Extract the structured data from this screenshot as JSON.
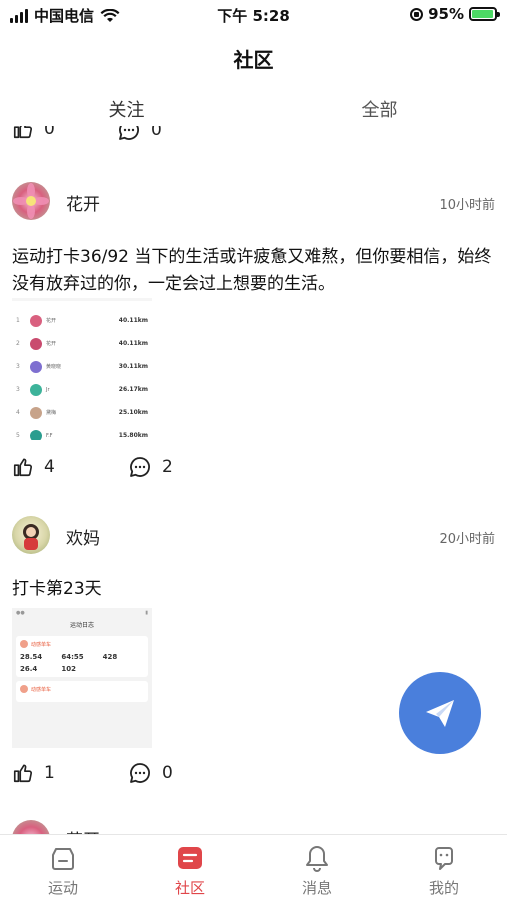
{
  "status_bar": {
    "carrier": "中国电信",
    "time": "下午 5:28",
    "battery": "95%"
  },
  "header": {
    "title": "社区"
  },
  "tabs": [
    {
      "label": "关注"
    },
    {
      "label": "全部"
    }
  ],
  "feed": {
    "partial_top": {
      "likes": "0",
      "comments": "0"
    },
    "posts": [
      {
        "username": "花开",
        "time": "10小时前",
        "text": "运动打卡36/92 当下的生活或许疲惫又难熬，但你要相信，始终没有放弃过的你，一定会过上想要的生活。",
        "likes": "4",
        "comments": "2",
        "image": {
          "rows": [
            {
              "rank": "1",
              "name": "花开",
              "value": "40.11km",
              "color": "#d9607f"
            },
            {
              "rank": "2",
              "name": "花开",
              "value": "40.11km",
              "color": "#c94b6e"
            },
            {
              "rank": "3",
              "name": "黄晓晓",
              "value": "30.11km",
              "color": "#7e6fd0"
            },
            {
              "rank": "3",
              "name": "Jr",
              "value": "26.17km",
              "color": "#3db39a"
            },
            {
              "rank": "4",
              "name": "黛梅",
              "value": "25.10km",
              "color": "#c7a38a"
            },
            {
              "rank": "5",
              "name": "F.F",
              "value": "15.80km",
              "color": "#2a9d8f"
            }
          ]
        }
      },
      {
        "username": "欢妈",
        "time": "20小时前",
        "text": "打卡第23天",
        "likes": "1",
        "comments": "0",
        "image": {
          "title": "运动日志",
          "card1_title": "动感单车",
          "stats": [
            "28.54",
            "64:55",
            "428",
            "26.4",
            "102"
          ],
          "card2_title": "动感单车"
        }
      }
    ],
    "next_post_name": "花开"
  },
  "bottom_nav": [
    {
      "label": "运动",
      "active": false
    },
    {
      "label": "社区",
      "active": true
    },
    {
      "label": "消息",
      "active": false
    },
    {
      "label": "我的",
      "active": false
    }
  ],
  "colors": {
    "accent": "#e0464a",
    "fab": "#4a7fdc",
    "battery": "#4cd964"
  }
}
